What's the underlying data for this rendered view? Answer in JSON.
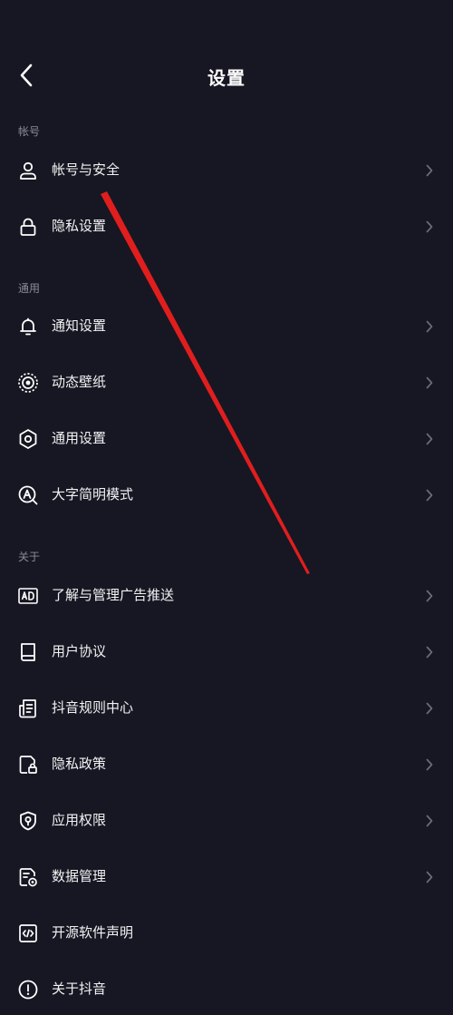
{
  "header": {
    "title": "设置",
    "back_icon": "chevron-left-icon"
  },
  "sections": [
    {
      "title": "帐号",
      "items": [
        {
          "label": "帐号与安全",
          "icon": "user-icon",
          "chevron": true
        },
        {
          "label": "隐私设置",
          "icon": "lock-icon",
          "chevron": true
        }
      ]
    },
    {
      "title": "通用",
      "items": [
        {
          "label": "通知设置",
          "icon": "bell-icon",
          "chevron": true
        },
        {
          "label": "动态壁纸",
          "icon": "live-wallpaper-icon",
          "chevron": true
        },
        {
          "label": "通用设置",
          "icon": "gear-icon",
          "chevron": true
        },
        {
          "label": "大字简明模式",
          "icon": "large-text-icon",
          "chevron": true
        }
      ]
    },
    {
      "title": "关于",
      "items": [
        {
          "label": "了解与管理广告推送",
          "icon": "ad-icon",
          "chevron": true
        },
        {
          "label": "用户协议",
          "icon": "book-icon",
          "chevron": true
        },
        {
          "label": "抖音规则中心",
          "icon": "document-icon",
          "chevron": true
        },
        {
          "label": "隐私政策",
          "icon": "privacy-doc-icon",
          "chevron": true
        },
        {
          "label": "应用权限",
          "icon": "shield-icon",
          "chevron": true
        },
        {
          "label": "数据管理",
          "icon": "data-doc-icon",
          "chevron": true
        },
        {
          "label": "开源软件声明",
          "icon": "code-icon",
          "chevron": false
        },
        {
          "label": "关于抖音",
          "icon": "info-icon",
          "chevron": false
        }
      ]
    }
  ],
  "colors": {
    "background": "#161722",
    "text": "#f2f2f4",
    "section_title": "#8a8b94",
    "chevron": "#6b6c75",
    "annotation": "#e01e1e"
  }
}
